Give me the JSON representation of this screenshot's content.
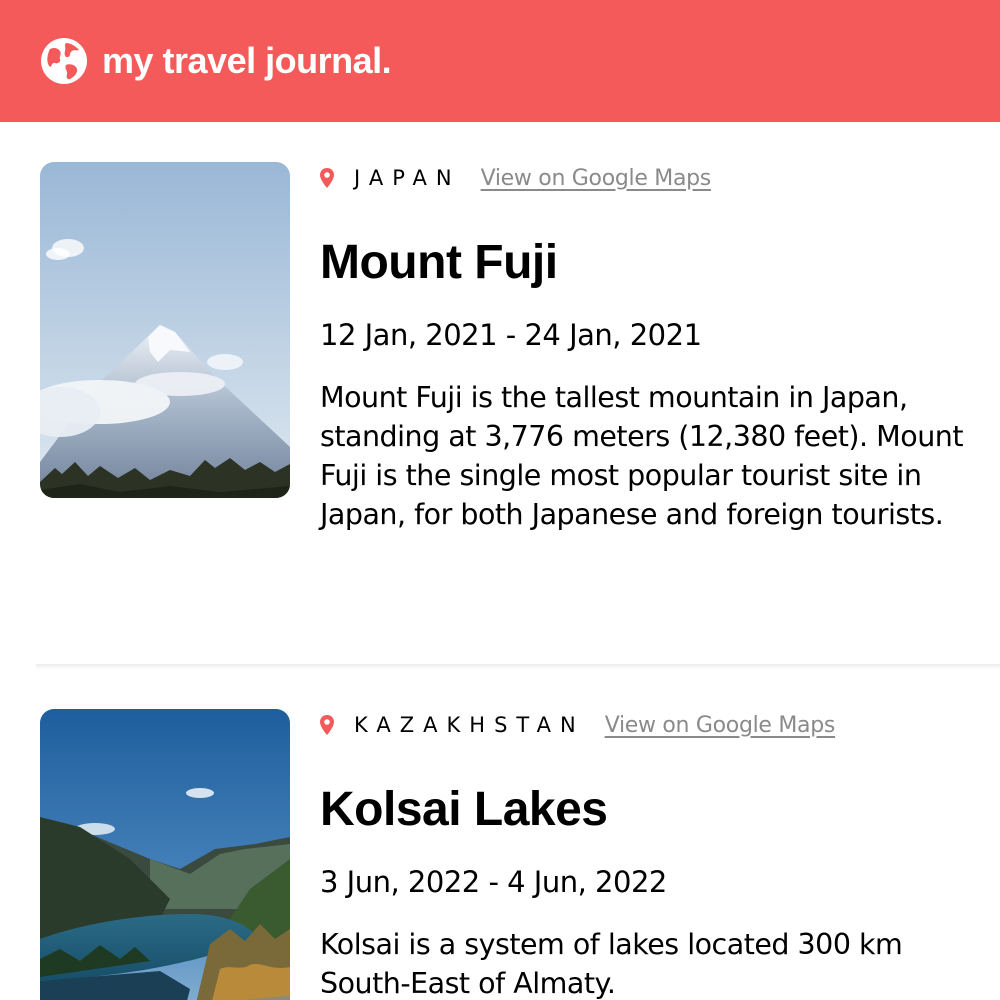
{
  "header": {
    "title": "my travel journal.",
    "icon": "globe-icon",
    "background": "#F55A5A"
  },
  "entries": [
    {
      "location": "JAPAN",
      "maps_link_label": "View on Google Maps",
      "title": "Mount Fuji",
      "dates": "12 Jan, 2021 - 24 Jan, 2021",
      "description": "Mount Fuji is the tallest mountain in Japan, standing at 3,776 meters (12,380 feet). Mount Fuji is the single most popular tourist site in Japan, for both Japanese and foreign tourists.",
      "photo": "mount-fuji-photo"
    },
    {
      "location": "KAZAKHSTAN",
      "maps_link_label": "View on Google Maps",
      "title": "Kolsai Lakes",
      "dates": "3 Jun, 2022 - 4 Jun, 2022",
      "description": "Kolsai is a system of lakes located 300 km South-East of Almaty.",
      "photo": "kolsai-lakes-photo"
    }
  ],
  "colors": {
    "accent": "#F55A5A",
    "link": "#8a8a8a"
  }
}
